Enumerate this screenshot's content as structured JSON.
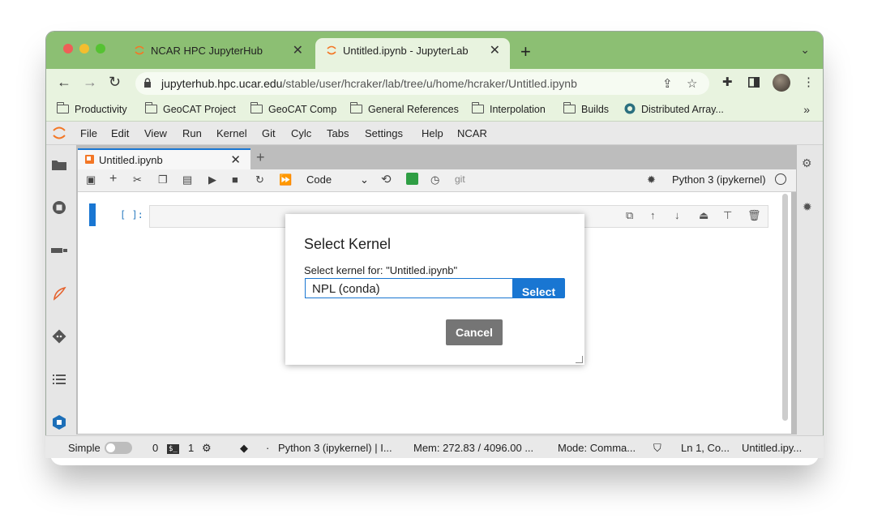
{
  "browser": {
    "tabs": [
      {
        "label": "NCAR HPC JupyterHub"
      },
      {
        "label": "Untitled.ipynb - JupyterLab"
      }
    ],
    "url_host": "jupyterhub.hpc.ucar.edu",
    "url_path": "/stable/user/hcraker/lab/tree/u/home/hcraker/Untitled.ipynb",
    "bookmarks": [
      "Productivity",
      "GeoCAT Project",
      "GeoCAT Comp",
      "General References",
      "Interpolation",
      "Builds",
      "Distributed Array..."
    ],
    "more": "»"
  },
  "menu": [
    "File",
    "Edit",
    "View",
    "Run",
    "Kernel",
    "Git",
    "Cylc",
    "Tabs",
    "Settings",
    "Help",
    "NCAR"
  ],
  "notebook": {
    "tab_title": "Untitled.ipynb",
    "cell_type": "Code",
    "git_label": "git",
    "kernel_name": "Python 3 (ipykernel)",
    "prompt": "[ ]:"
  },
  "statusbar": {
    "mode_label": "Simple",
    "count_a": "0",
    "terminal_icon": "$_",
    "count_b": "1",
    "dot": "·",
    "kernel": "Python 3 (ipykernel) | I...",
    "mem": "Mem: 272.83 / 4096.00 ...",
    "mode": "Mode: Comma...",
    "cursor": "Ln 1, Co...",
    "file": "Untitled.ipy..."
  },
  "dialog": {
    "title": "Select Kernel",
    "label": "Select kernel for: \"Untitled.ipynb\"",
    "selected": "NPL (conda)",
    "cancel": "Cancel",
    "select": "Select"
  },
  "colors": {
    "chrome_green": "#8cbf73",
    "accent": "#1976d2",
    "cancel_gray": "#757575"
  }
}
